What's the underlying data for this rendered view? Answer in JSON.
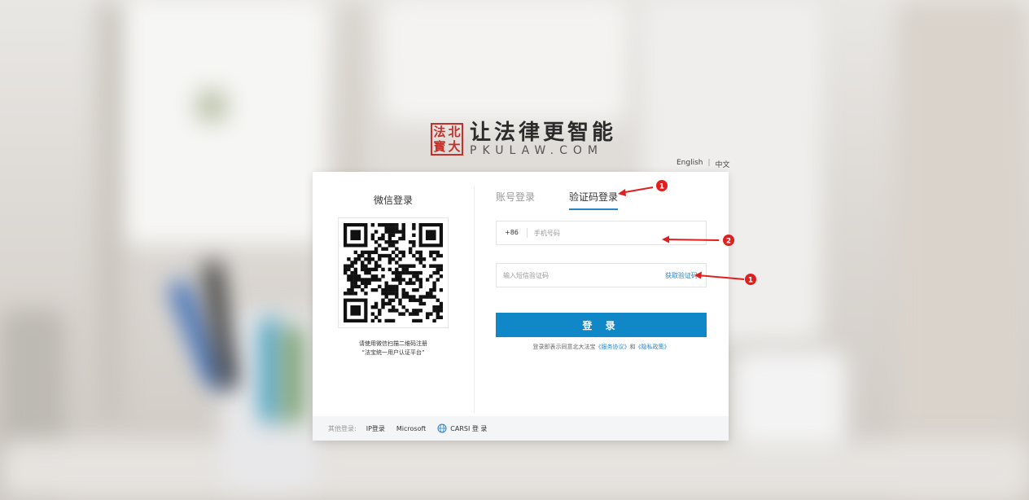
{
  "logo": {
    "seal_chars": [
      "法",
      "北",
      "寳",
      "大"
    ],
    "slogan": "让法律更智能",
    "domain": "PKULAW.COM"
  },
  "lang": {
    "english": "English",
    "sep": "|",
    "chinese": "中文"
  },
  "wechat": {
    "title": "微信登录",
    "hint_line1": "请使用微信扫描二维码注册",
    "hint_line2": "“法宝统一用户认证平台”"
  },
  "tabs": [
    {
      "label": "账号登录",
      "active": false
    },
    {
      "label": "验证码登录",
      "active": true
    }
  ],
  "phone": {
    "country_code": "+86",
    "placeholder": "手机号码"
  },
  "code": {
    "placeholder": "输入短信验证码",
    "get_code": "获取验证码"
  },
  "login_button": "登 录",
  "agreement": {
    "prefix": "登录即表示同意北大法宝",
    "terms": "《服务协议》",
    "and": "和",
    "privacy": "《隐私政策》"
  },
  "footer": {
    "other_label": "其他登录:",
    "items": [
      "IP登录",
      "Microsoft",
      "CARSI 登 录"
    ]
  },
  "annotations": [
    "1",
    "2",
    "1"
  ],
  "colors": {
    "accent": "#1088c8",
    "link": "#2a84c6",
    "seal": "#c4302b",
    "annotation": "#e01f1f"
  }
}
